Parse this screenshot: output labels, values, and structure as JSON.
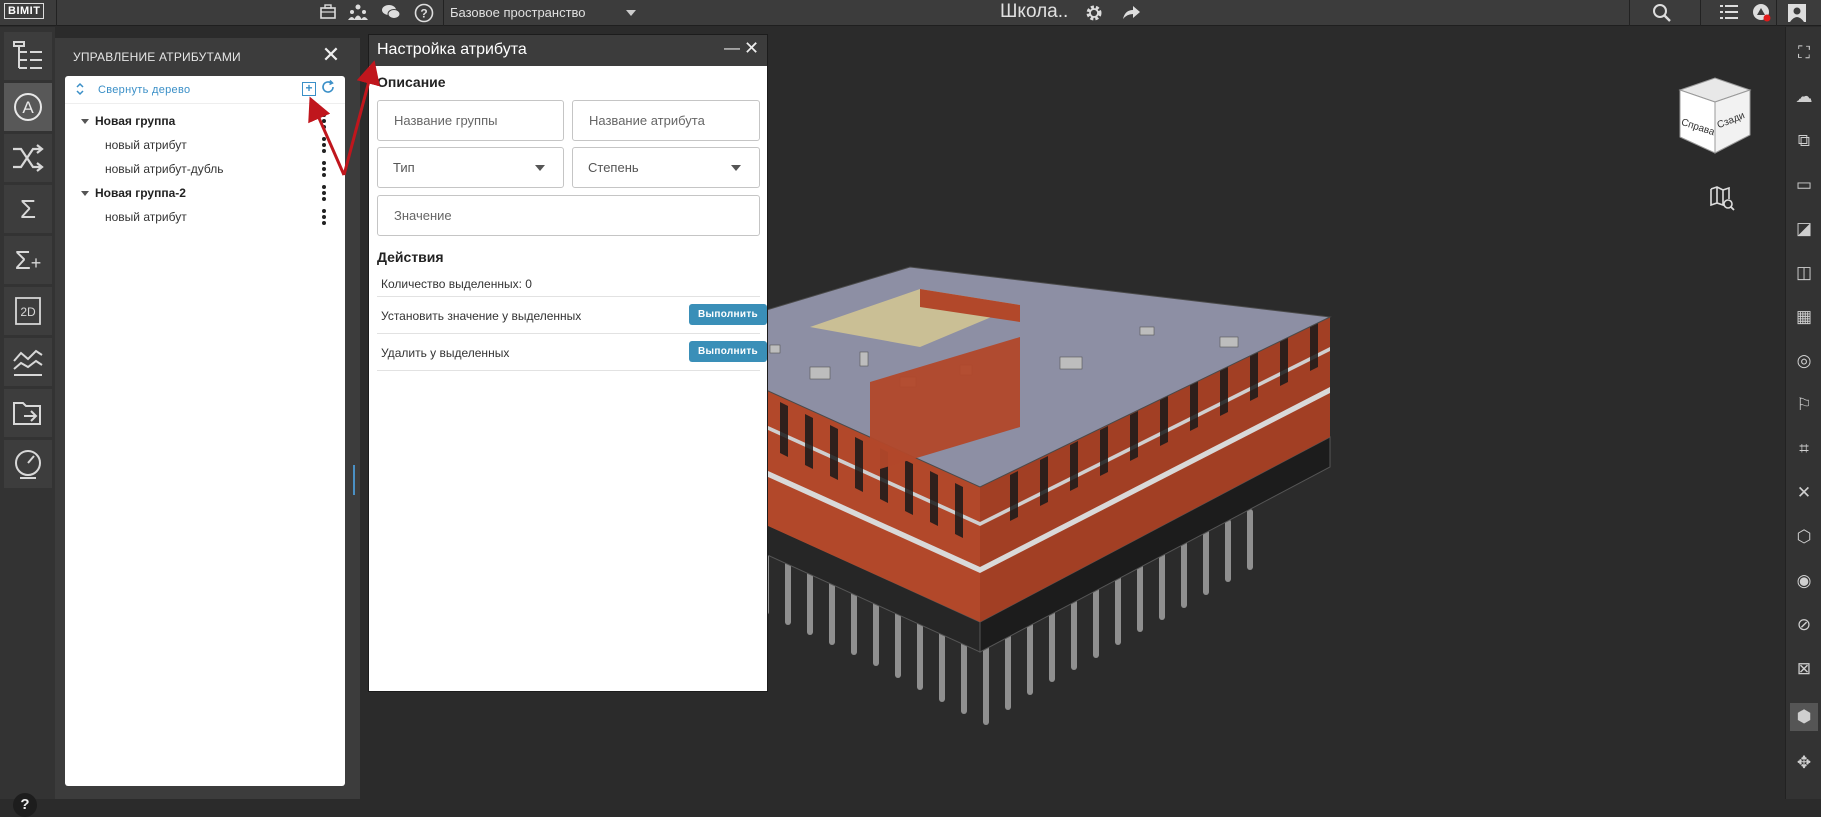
{
  "topbar": {
    "logo": "BIMIT",
    "space_name": "Базовое пространство",
    "project_title": "Школа.."
  },
  "attr_panel": {
    "title": "УПРАВЛЕНИЕ АТРИБУТАМИ",
    "collapse_tree_label": "Свернуть дерево",
    "tree": [
      {
        "label": "Новая группа",
        "type": "group"
      },
      {
        "label": "новый атрибут",
        "type": "leaf"
      },
      {
        "label": "новый атрибут-дубль",
        "type": "leaf"
      },
      {
        "label": "Новая группа-2",
        "type": "group"
      },
      {
        "label": "новый атрибут",
        "type": "leaf"
      }
    ]
  },
  "dialog": {
    "title": "Настройка атрибута",
    "description_title": "Описание",
    "group_name_placeholder": "Название группы",
    "attribute_name_placeholder": "Название атрибута",
    "type_label": "Тип",
    "degree_label": "Степень",
    "value_placeholder": "Значение",
    "actions_title": "Действия",
    "selected_count": "Количество выделенных: 0",
    "set_value_label": "Установить значение у выделенных",
    "delete_label": "Удалить у выделенных",
    "execute_label": "Выполнить"
  },
  "viewcube": {
    "face_front": "Справа",
    "face_side": "Сзади"
  },
  "help_label": "?",
  "colors": {
    "accent": "#3a8fb8",
    "annotation": "#c0161d",
    "brick": "#b2482a",
    "roof": "#8d8fa4"
  }
}
